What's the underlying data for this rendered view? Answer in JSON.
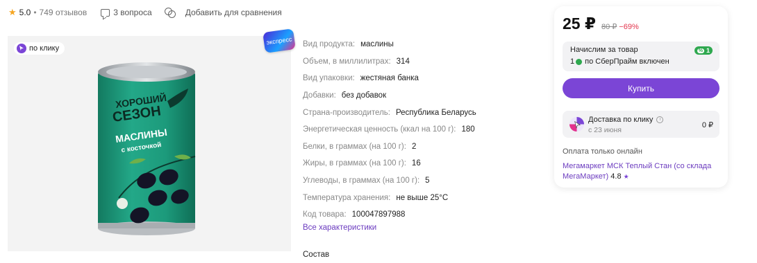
{
  "meta": {
    "rating": "5.0",
    "separator": "•",
    "reviews": "749 отзывов",
    "questions": "3 вопроса",
    "compare": "Добавить для сравнения"
  },
  "gallery": {
    "badge_click": "по клику",
    "badge_express": "экспресс",
    "can_brand_line1": "ХОРОШИЙ",
    "can_brand_line2": "СЕЗОН",
    "can_product_line1": "МАСЛИНЫ",
    "can_product_line2": "с косточкой"
  },
  "specs": [
    {
      "key": "Вид продукта:",
      "value": "маслины"
    },
    {
      "key": "Объем, в миллилитрах:",
      "value": "314"
    },
    {
      "key": "Вид упаковки:",
      "value": "жестяная банка"
    },
    {
      "key": "Добавки:",
      "value": "без добавок"
    },
    {
      "key": "Страна-производитель:",
      "value": "Республика Беларусь"
    },
    {
      "key": "Энергетическая ценность (ккал на 100 г):",
      "value": "180"
    },
    {
      "key": "Белки, в граммах (на 100 г):",
      "value": "2"
    },
    {
      "key": "Жиры, в граммах (на 100 г):",
      "value": "16"
    },
    {
      "key": "Углеводы, в граммах (на 100 г):",
      "value": "5"
    },
    {
      "key": "Температура хранения:",
      "value": "не выше 25°С"
    },
    {
      "key": "Код товара:",
      "value": "100047897988"
    }
  ],
  "all_specs_link": "Все характеристики",
  "composition_title": "Состав",
  "card": {
    "price": "25 ₽",
    "old_price": "80 ₽",
    "discount": "−69%",
    "bonus_title": "Начислим за товар",
    "bonus_chip_pct": "%",
    "bonus_chip_value": "1",
    "bonus_sub_num": "1",
    "bonus_sub_text": "по СберПрайм включен",
    "buy_label": "Купить",
    "delivery_title": "Доставка по клику",
    "delivery_info": "i",
    "delivery_date": "с 23 июня",
    "delivery_price": "0 ₽",
    "payment_note": "Оплата только онлайн",
    "seller_name": "Мегамаркет МСК Теплый Стан (со склада МегаМаркет)",
    "seller_rating": "4.8",
    "seller_star": "★"
  },
  "colors": {
    "accent": "#7b45d6",
    "discount": "#e2334b",
    "bonus_green": "#2fa84f",
    "star": "#f5a623",
    "can_green": "#1f9c7e"
  }
}
